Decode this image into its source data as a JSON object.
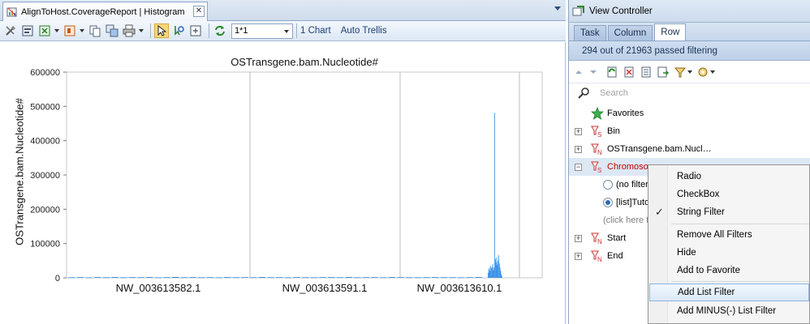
{
  "left_panel": {
    "tab_title": "AlignToHost.CoverageReport | Histogram",
    "toolbar": {
      "trellis_value": "1*1",
      "link_one_chart": "1 Chart",
      "link_auto_trellis": "Auto Trellis"
    }
  },
  "chart_data": {
    "type": "bar",
    "title": "OSTransgene.bam.Nucleotide#",
    "xlabel": "",
    "ylabel": "OSTransgene.bam.Nucleotide#",
    "ylim": [
      0,
      600000
    ],
    "yticks": [
      "0",
      "100000",
      "200000",
      "300000",
      "400000",
      "500000",
      "600000"
    ],
    "categories": [
      "NW_003613582.1",
      "NW_003613591.1",
      "NW_003613610.1"
    ],
    "series": [
      {
        "values": [
          1500,
          1800,
          1200,
          2000,
          1600,
          2200,
          1400,
          1900,
          1700,
          2100,
          1300,
          1800,
          2400,
          1600,
          2000,
          1500,
          1800,
          1400,
          2100,
          1700,
          1900,
          1500,
          2300,
          1600,
          1800,
          1400,
          2000,
          1700,
          1500,
          1900,
          2000,
          1600,
          2200,
          1500,
          1700,
          1900,
          1400,
          2100,
          1800,
          1600,
          1500,
          1700,
          2000,
          1800,
          1600,
          1400,
          1900,
          2100,
          15000,
          25000,
          30000,
          20000,
          35000,
          28000,
          32000,
          40000,
          22000,
          30000,
          481000,
          55000,
          45000,
          60000,
          38000,
          50000,
          66000,
          42000,
          30000,
          20000,
          10000,
          4000
        ]
      }
    ],
    "segment_boundaries": [
      "NW_003613582.1 | NW_003613591.1",
      "NW_003613591.1 | NW_003613610.1",
      "NW_003613610.1 | end"
    ],
    "grid": false
  },
  "view_controller": {
    "title": "View Controller",
    "tabs": [
      "Task",
      "Column",
      "Row"
    ],
    "active_tab": "Row",
    "summary": "294 out of 21963 passed filtering",
    "search_placeholder": "Search",
    "tree": {
      "favorites": "Favorites",
      "bin": "Bin",
      "nucleotide": "OSTransgene.bam.Nucl…",
      "chromosome": "Chromoson",
      "radio_no_filter": "(no filter",
      "radio_list": "[list]Tuto",
      "hint": "(click here t",
      "start": "Start",
      "end": "End"
    }
  },
  "context_menu": {
    "items": [
      "Radio",
      "CheckBox",
      "String Filter",
      "Remove All Filters",
      "Hide",
      "Add to Favorite",
      "Add List Filter",
      "Add MINUS(-) List Filter"
    ],
    "checked_item": "String Filter",
    "highlighted_item": "Add List Filter"
  },
  "colors": {
    "bar": "#2f8be6",
    "accent": "#1f3f73",
    "filter_red": "#c00000"
  }
}
